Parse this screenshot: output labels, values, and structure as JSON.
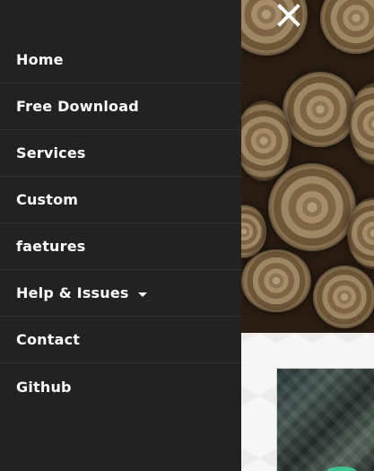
{
  "menu": {
    "items": [
      {
        "label": "Home"
      },
      {
        "label": "Free Download"
      },
      {
        "label": "Services"
      },
      {
        "label": "Custom"
      },
      {
        "label": "faetures"
      },
      {
        "label": "Help & Issues",
        "has_dropdown": true
      },
      {
        "label": "Contact"
      },
      {
        "label": "Github"
      }
    ]
  },
  "icons": {
    "close": "close-icon",
    "dropdown": "caret-down-icon"
  },
  "colors": {
    "menu_background": "#222222",
    "menu_divider": "#333333",
    "menu_text": "#ffffff",
    "accent": "#3fd49a"
  }
}
